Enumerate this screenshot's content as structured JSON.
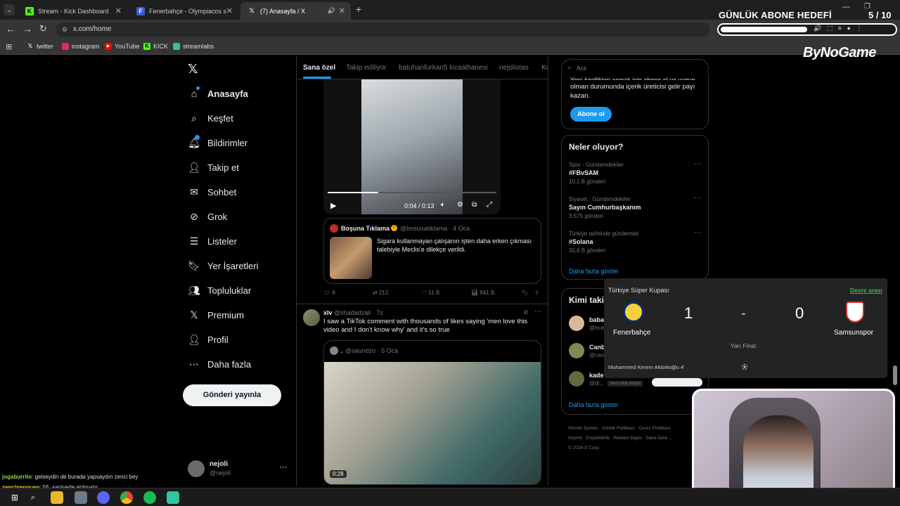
{
  "browser": {
    "tabs": [
      {
        "label": "Stream - Kick Dashboard",
        "icon": "K"
      },
      {
        "label": "Fenerbahçe - Olympiacos skoru",
        "icon": "F"
      },
      {
        "label": "(7) Anasayfa / X",
        "icon": "X"
      }
    ],
    "url": "x.com/home",
    "bookmarks": [
      "twitter",
      "instagram",
      "YouTube",
      "KICK",
      "streamlabs"
    ]
  },
  "overlay": {
    "goal_title": "GÜNLÜK ABONE HEDEFİ",
    "goal_count": "5 / 10",
    "goal_progress": 0.5,
    "brand": "ByNoGame"
  },
  "nav": {
    "items": [
      "Anasayfa",
      "Keşfet",
      "Bildirimler",
      "Takip et",
      "Sohbet",
      "Grok",
      "Listeler",
      "Yer İşaretleri",
      "Topluluklar",
      "Premium",
      "Profil",
      "Daha fazla"
    ],
    "post_button": "Gönderi yayınla",
    "user_name": "nejoli",
    "user_handle": "@nejoli"
  },
  "timeline": {
    "tabs": [
      "Sana özel",
      "Takip ediliyor",
      "batuhanfurkan5 kıraathanesi",
      "nejolistas",
      "Ko"
    ],
    "tweet1": {
      "video_time": "0:04 / 0:13",
      "quote_name": "Boşuna Tıklama",
      "quote_handle": "@bosunatiklama · 4 Oca",
      "quote_text": "Sigara kullanmayan çalışanın işten daha erken çıkması talebiyle Meclis'e dilekçe verildi.",
      "replies": "8",
      "retweets": "212",
      "likes": "11 B",
      "views": "841 B"
    },
    "tweet2": {
      "name": "xlv",
      "handle": "@shadadzail · 7s",
      "text": "I saw a TikTok comment with thousands of likes saying 'men love this video and I don't know why' and it's so true",
      "quote_name": ".",
      "quote_handle": "@saundzo · 5 Oca",
      "video_duration": "0:28"
    }
  },
  "right": {
    "search_placeholder": "Ara",
    "subscribe_text": "olman durumunda içerik üreticisi gelir payı kazan.",
    "subscribe_partial": "Yeni özellikleri açmak için abone ol ve uygun",
    "subscribe_button": "Abone ol",
    "trends_title": "Neler oluyor?",
    "trends": [
      {
        "meta": "Spor · Gündemdekiler",
        "name": "#FBvSAM",
        "count": "10,1 B gönderi"
      },
      {
        "meta": "Siyaset · Gündemdekiler",
        "name": "Sayın Cumhurbaşkanım",
        "count": "3.575 gönderi"
      },
      {
        "meta": "Türkiye tarihinde gündemde",
        "name": "#Solana",
        "count": "30,6 B gönderi"
      }
    ],
    "show_more": "Daha fazla göster",
    "who_title": "Kimi takip",
    "who": [
      {
        "name": "baba",
        "handle": "@ece"
      },
      {
        "name": "Canb",
        "handle": "@can"
      },
      {
        "name": "kade",
        "handle": "@di..."
      }
    ],
    "follows_you": "Seni takip ediyor",
    "who_show_more": "Daha fazla göster",
    "footer": [
      "Hizmet Şartları",
      "Gizlilik Politikası",
      "Çerez Politikası",
      "Imprint",
      "Erişilebilirlik",
      "Reklam bilgisi",
      "Daha fazla ...",
      "© 2026 X Corp."
    ]
  },
  "score": {
    "competition": "Türkiye Süper Kupası",
    "status": "Devre arası",
    "home": "Fenerbahçe",
    "away": "Samsunspor",
    "home_score": "1",
    "sep": "-",
    "away_score": "0",
    "stage": "Yarı Final",
    "scorer": "Muhammed Kerem Aktürkoğlu 4'"
  },
  "chat": [
    {
      "user": "jogaburrito",
      "msg": ": gelseydin de burada yapsaydın zenci bey"
    },
    {
      "user": "zencipenguen",
      "msg": ": 55. saniyede atılmıştır"
    }
  ]
}
